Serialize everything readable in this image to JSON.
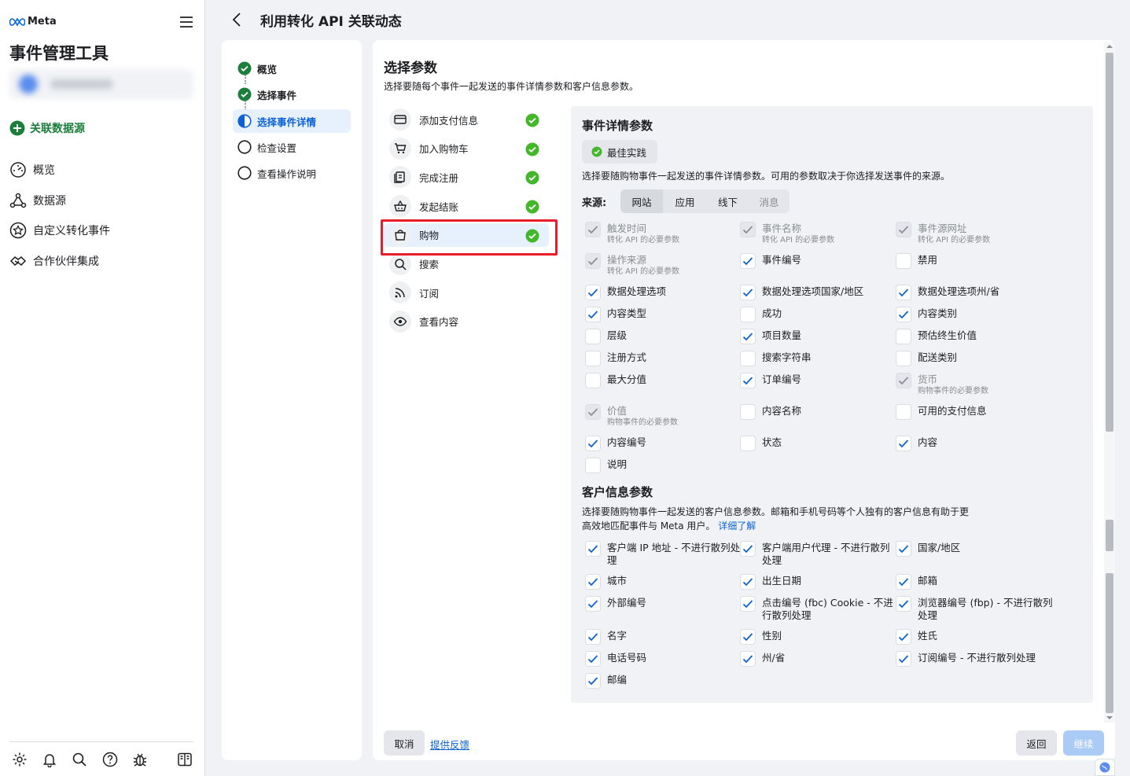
{
  "app": {
    "brand": "Meta",
    "title": "事件管理工具"
  },
  "sidebar": {
    "connect_label": "关联数据源",
    "items": [
      {
        "label": "概览"
      },
      {
        "label": "数据源"
      },
      {
        "label": "自定义转化事件"
      },
      {
        "label": "合作伙伴集成"
      }
    ]
  },
  "header": {
    "title": "利用转化 API 关联动态"
  },
  "steps": [
    {
      "label": "概览",
      "state": "done"
    },
    {
      "label": "选择事件",
      "state": "done"
    },
    {
      "label": "选择事件详情",
      "state": "current"
    },
    {
      "label": "检查设置",
      "state": "todo"
    },
    {
      "label": "查看操作说明",
      "state": "todo"
    }
  ],
  "main": {
    "title": "选择参数",
    "subtitle": "选择要随每个事件一起发送的事件详情参数和客户信息参数。"
  },
  "events": [
    {
      "label": "添加支付信息",
      "icon": "credit-card-icon",
      "done": true
    },
    {
      "label": "加入购物车",
      "icon": "cart-icon",
      "done": true
    },
    {
      "label": "完成注册",
      "icon": "registration-icon",
      "done": true
    },
    {
      "label": "发起结账",
      "icon": "basket-icon",
      "done": true
    },
    {
      "label": "购物",
      "icon": "shopping-bag-icon",
      "done": true
    },
    {
      "label": "搜索",
      "icon": "search-icon",
      "done": false
    },
    {
      "label": "订阅",
      "icon": "rss-icon",
      "done": false
    },
    {
      "label": "查看内容",
      "icon": "eye-icon",
      "done": false
    }
  ],
  "event_details": {
    "title": "事件详情参数",
    "best_practice": "最佳实践",
    "desc": "选择要随购物事件一起发送的事件详情参数。可用的参数取决于你选择发送事件的来源。",
    "source_label": "来源:",
    "sources": [
      "网站",
      "应用",
      "线下",
      "消息"
    ],
    "params": [
      {
        "label": "触发时间",
        "sub": "转化 API 的必要参数",
        "state": "locked"
      },
      {
        "label": "事件名称",
        "sub": "转化 API 的必要参数",
        "state": "locked"
      },
      {
        "label": "事件源网址",
        "sub": "转化 API 的必要参数",
        "state": "locked"
      },
      {
        "label": "操作来源",
        "sub": "转化 API 的必要参数",
        "state": "locked"
      },
      {
        "label": "事件编号",
        "sub": "",
        "state": "checked"
      },
      {
        "label": "禁用",
        "sub": "",
        "state": "unchecked"
      },
      {
        "label": "数据处理选项",
        "sub": "",
        "state": "checked"
      },
      {
        "label": "数据处理选项国家/地区",
        "sub": "",
        "state": "checked"
      },
      {
        "label": "数据处理选项州/省",
        "sub": "",
        "state": "checked"
      },
      {
        "label": "内容类型",
        "sub": "",
        "state": "checked"
      },
      {
        "label": "成功",
        "sub": "",
        "state": "unchecked"
      },
      {
        "label": "内容类别",
        "sub": "",
        "state": "checked"
      },
      {
        "label": "层级",
        "sub": "",
        "state": "unchecked"
      },
      {
        "label": "项目数量",
        "sub": "",
        "state": "checked"
      },
      {
        "label": "预估终生价值",
        "sub": "",
        "state": "unchecked"
      },
      {
        "label": "注册方式",
        "sub": "",
        "state": "unchecked"
      },
      {
        "label": "搜索字符串",
        "sub": "",
        "state": "unchecked"
      },
      {
        "label": "配送类别",
        "sub": "",
        "state": "unchecked"
      },
      {
        "label": "最大分值",
        "sub": "",
        "state": "unchecked"
      },
      {
        "label": "订单编号",
        "sub": "",
        "state": "checked"
      },
      {
        "label": "货币",
        "sub": "购物事件的必要参数",
        "state": "locked"
      },
      {
        "label": "价值",
        "sub": "购物事件的必要参数",
        "state": "locked"
      },
      {
        "label": "内容名称",
        "sub": "",
        "state": "unchecked"
      },
      {
        "label": "可用的支付信息",
        "sub": "",
        "state": "unchecked"
      },
      {
        "label": "内容编号",
        "sub": "",
        "state": "checked"
      },
      {
        "label": "状态",
        "sub": "",
        "state": "unchecked"
      },
      {
        "label": "内容",
        "sub": "",
        "state": "checked"
      },
      {
        "label": "说明",
        "sub": "",
        "state": "unchecked"
      }
    ]
  },
  "customer_info": {
    "title": "客户信息参数",
    "desc1": "选择要随购物事件一起发送的客户信息参数。邮箱和手机号码等个人独有的客户信息有助于更",
    "desc2": "高效地匹配事件与 Meta 用户。",
    "learn_more": "详细了解",
    "params": [
      {
        "label": "客户端 IP 地址 - 不进行散列处",
        "label2": "理",
        "state": "checked"
      },
      {
        "label": "客户端用户代理 - 不进行散列",
        "label2": "处理",
        "state": "checked"
      },
      {
        "label": "国家/地区",
        "label2": "",
        "state": "checked"
      },
      {
        "label": "城市",
        "label2": "",
        "state": "checked"
      },
      {
        "label": "出生日期",
        "label2": "",
        "state": "checked"
      },
      {
        "label": "邮箱",
        "label2": "",
        "state": "checked"
      },
      {
        "label": "外部编号",
        "label2": "",
        "state": "checked"
      },
      {
        "label": "点击编号 (fbc) Cookie - 不进",
        "label2": "行散列处理",
        "state": "checked"
      },
      {
        "label": "浏览器编号 (fbp) - 不进行散列",
        "label2": "处理",
        "state": "checked"
      },
      {
        "label": "名字",
        "label2": "",
        "state": "checked"
      },
      {
        "label": "性别",
        "label2": "",
        "state": "checked"
      },
      {
        "label": "姓氏",
        "label2": "",
        "state": "checked"
      },
      {
        "label": "电话号码",
        "label2": "",
        "state": "checked"
      },
      {
        "label": "州/省",
        "label2": "",
        "state": "checked"
      },
      {
        "label": "订阅编号 - 不进行散列处理",
        "label2": "",
        "state": "checked"
      },
      {
        "label": "邮编",
        "label2": "",
        "state": "checked"
      }
    ]
  },
  "footer": {
    "cancel": "取消",
    "feedback": "提供反馈",
    "back": "返回",
    "continue": "继续"
  },
  "colors": {
    "accent": "#0a62d6",
    "success": "#42b72a",
    "connect": "#1b7f3b",
    "highlight": "#e81c2b"
  }
}
